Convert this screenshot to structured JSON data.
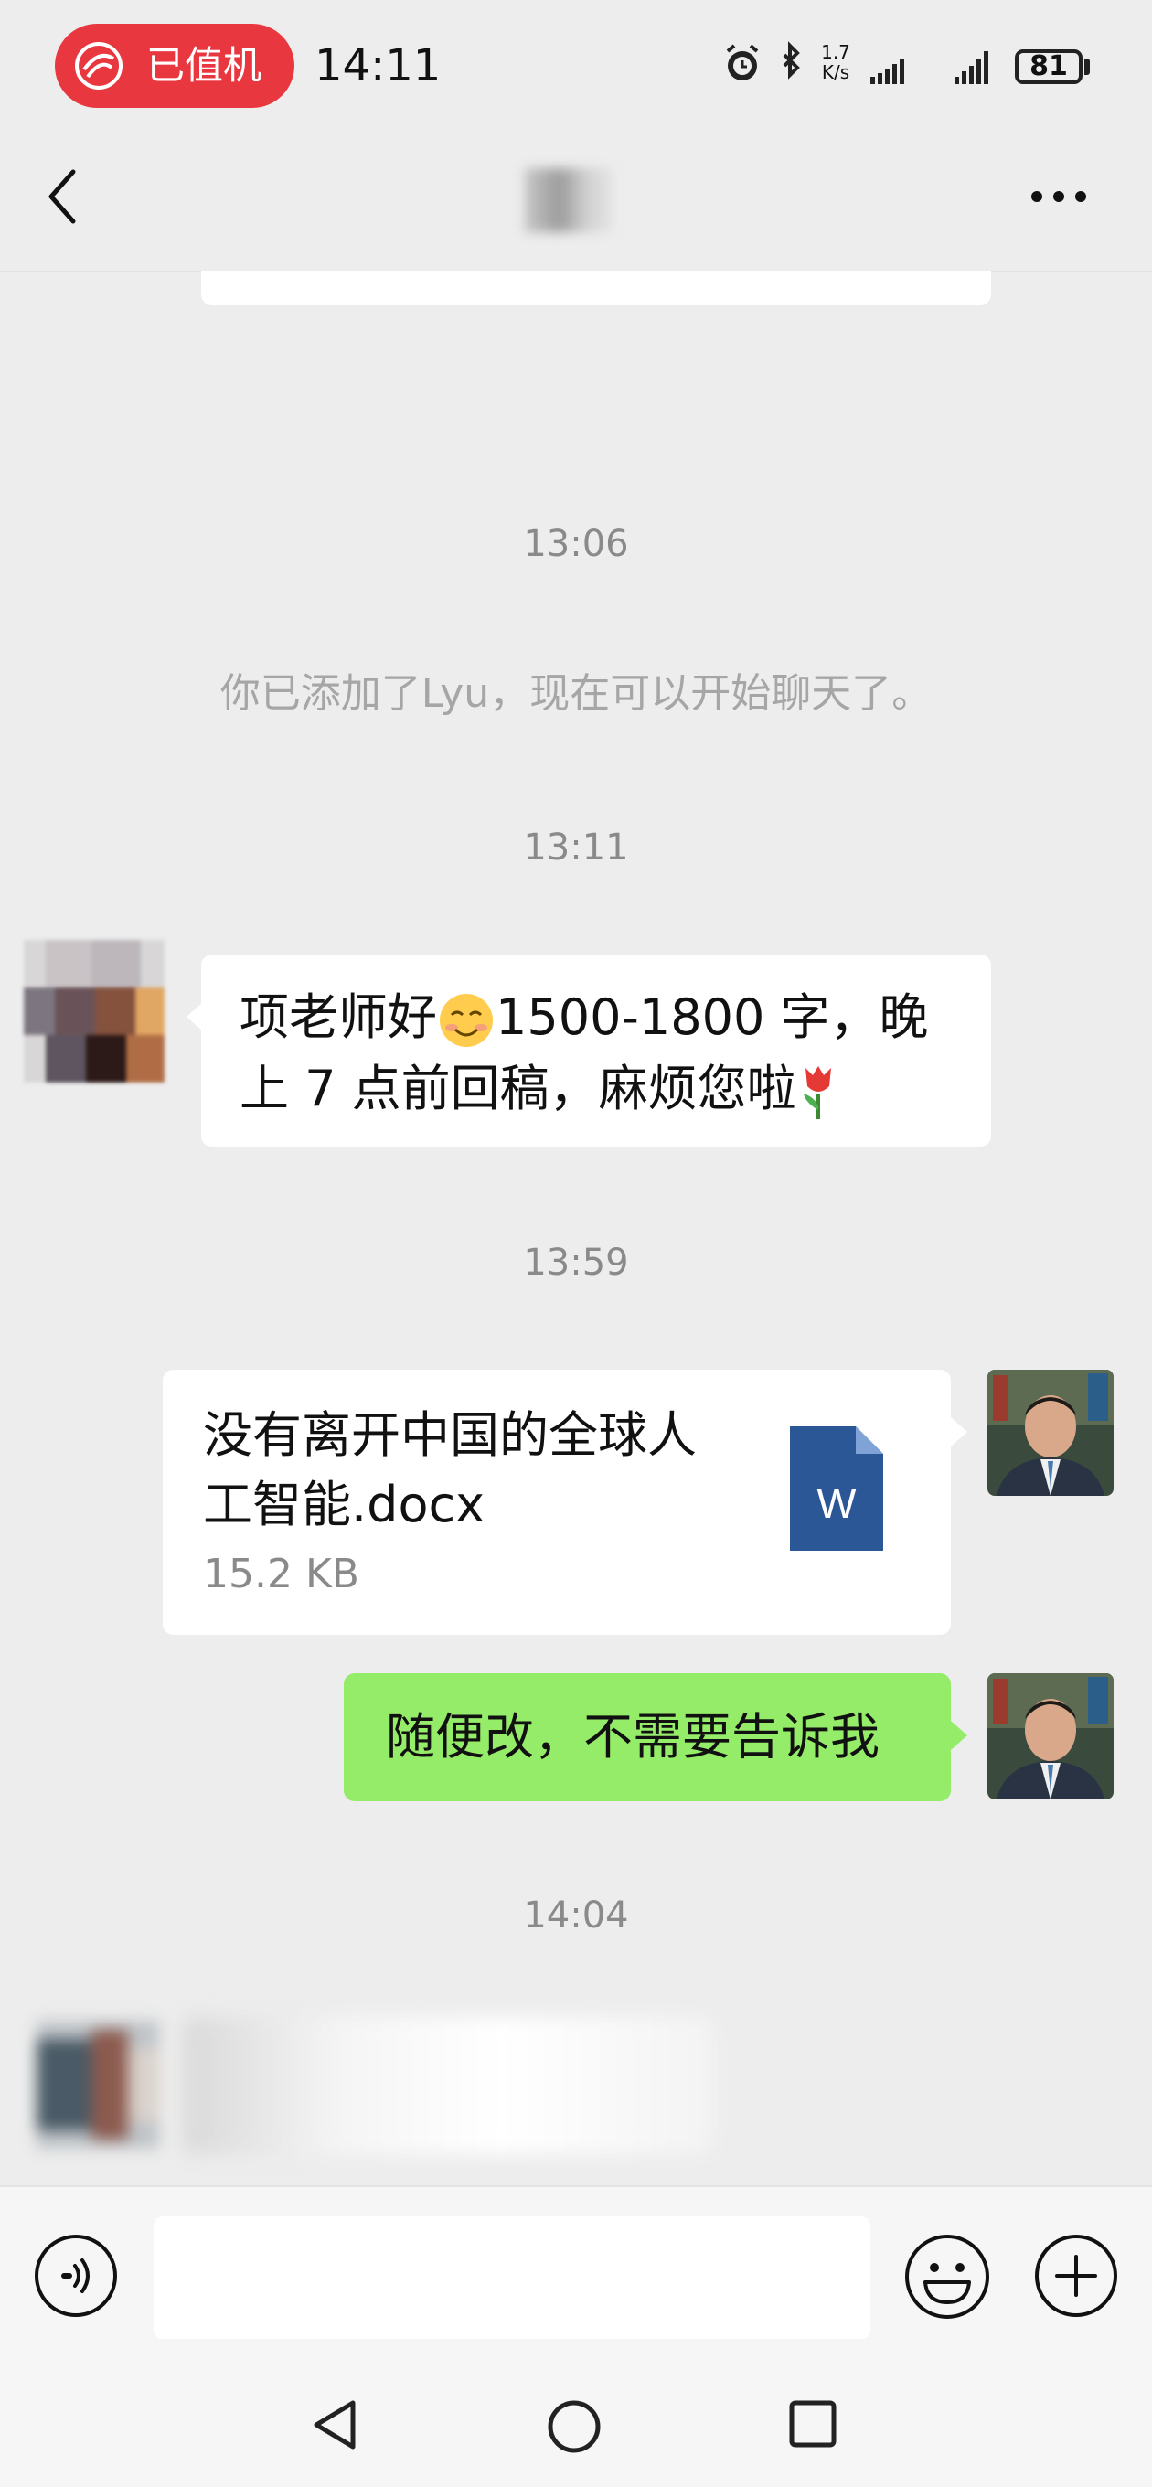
{
  "status_bar": {
    "flight_label": "已值机",
    "time": "14:11",
    "network_speed": "1.7 K/s",
    "battery": "81"
  },
  "chat": {
    "timestamps": [
      "13:06",
      "13:11",
      "13:59",
      "14:04"
    ],
    "system_message": "你已添加了Lyu，现在可以开始聊天了。",
    "messages": [
      {
        "sender": "contact",
        "text_part1": "项老师好",
        "emoji_1": "smiling-face",
        "text_part2": "1500-1800 字，晚上 7 点前回稿，麻烦您啦",
        "emoji_2": "tulip"
      },
      {
        "sender": "self",
        "type": "file",
        "file_name": "没有离开中国的全球人工智能.docx",
        "file_size": "15.2 KB",
        "file_icon": "word-document-icon",
        "file_icon_letter": "W"
      },
      {
        "sender": "self",
        "type": "text",
        "text": "随便改，不需要告诉我"
      }
    ]
  },
  "colors": {
    "background": "#ededed",
    "self_bubble": "#95ec69",
    "other_bubble": "#ffffff",
    "flight_pill": "#e8373f",
    "word_blue": "#2b5797"
  },
  "icons": {
    "back": "chevron-left-icon",
    "more": "more-dots-icon",
    "voice": "voice-input-icon",
    "emoji": "emoji-icon",
    "plus": "plus-icon"
  }
}
